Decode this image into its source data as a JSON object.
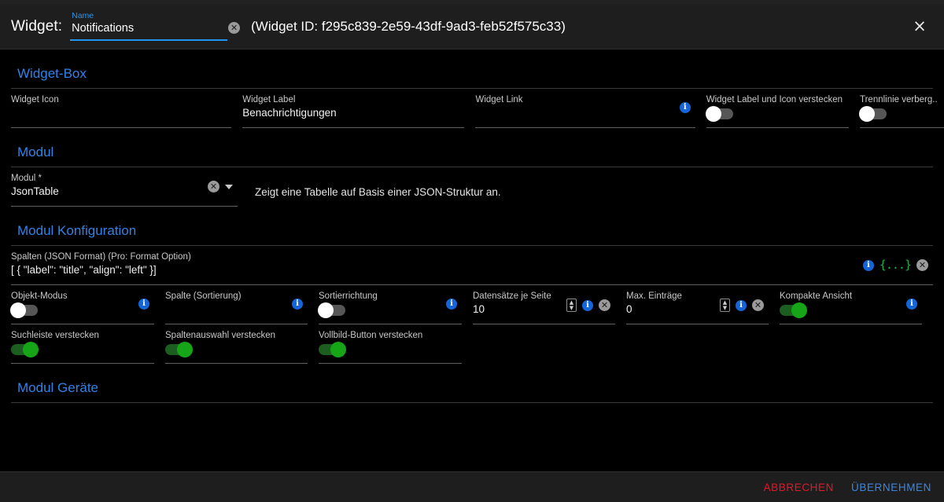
{
  "header": {
    "title": "Widget:",
    "name_label": "Name",
    "name_value": "Notifications",
    "clear_icon": "clear-circle-icon",
    "widget_id_text": "(Widget ID: f295c839-2e59-43df-9ad3-feb52f575c33)",
    "close_icon": "×"
  },
  "sections": {
    "widget_box": {
      "title": "Widget-Box",
      "fields": {
        "widget_icon": {
          "label": "Widget Icon",
          "value": ""
        },
        "widget_label": {
          "label": "Widget Label",
          "value": "Benachrichtigungen"
        },
        "widget_link": {
          "label": "Widget Link",
          "value": ""
        },
        "hide_label_icon": {
          "label": "Widget Label und Icon verstecken",
          "state": "off"
        },
        "hide_divider": {
          "label": "Trennlinie verberg...",
          "state": "off"
        }
      }
    },
    "modul": {
      "title": "Modul",
      "field_label": "Modul *",
      "field_value": "JsonTable",
      "description": "Zeigt eine Tabelle auf Basis einer JSON-Struktur an."
    },
    "modul_konfiguration": {
      "title": "Modul Konfiguration",
      "columns_json": {
        "label": "Spalten (JSON Format) (Pro: Format Option)",
        "value": "[ {    \"label\": \"title\",    \"align\": \"left\" }]",
        "json_icon": "{...}"
      },
      "row2": [
        {
          "label": "Objekt-Modus",
          "type": "toggle",
          "state": "off"
        },
        {
          "label": "Spalte (Sortierung)",
          "type": "text",
          "value": ""
        },
        {
          "label": "Sortierrichtung",
          "type": "toggle",
          "state": "off"
        },
        {
          "label": "Datensätze je Seite",
          "type": "number",
          "value": "10"
        },
        {
          "label": "Max. Einträge",
          "type": "number",
          "value": "0"
        },
        {
          "label": "Kompakte Ansicht",
          "type": "toggle",
          "state": "on"
        }
      ],
      "row3": [
        {
          "label": "Suchleiste verstecken",
          "state": "on"
        },
        {
          "label": "Spaltenauswahl verstecken",
          "state": "on"
        },
        {
          "label": "Vollbild-Button verstecken",
          "state": "on"
        }
      ]
    },
    "modul_geraete": {
      "title": "Modul Geräte"
    }
  },
  "footer": {
    "cancel": "ABBRECHEN",
    "apply": "ÜBERNEHMEN"
  },
  "colors": {
    "accent_blue": "#2f83e8",
    "info_blue": "#1565d8",
    "toggle_on_green": "#16a516",
    "cancel_red": "#e3182a",
    "json_green": "#18b24a"
  }
}
